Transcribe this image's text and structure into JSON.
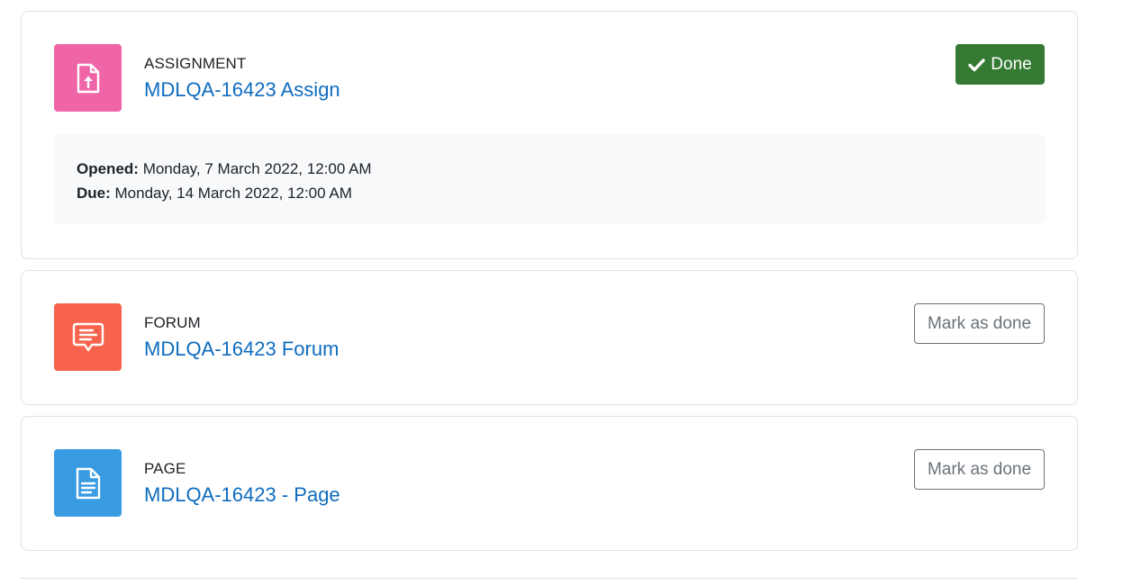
{
  "activities": [
    {
      "type": "ASSIGNMENT",
      "title": "MDLQA-16423 Assign",
      "icon": "assign-upload-icon",
      "icon_color": "#f065a8",
      "completion": {
        "label": "Done",
        "state": "done",
        "icon": "check-icon"
      },
      "dates": [
        {
          "label": "Opened:",
          "value": "Monday, 7 March 2022, 12:00 AM"
        },
        {
          "label": "Due:",
          "value": "Monday, 14 March 2022, 12:00 AM"
        }
      ]
    },
    {
      "type": "FORUM",
      "title": "MDLQA-16423 Forum",
      "icon": "forum-chat-icon",
      "icon_color": "#f7634d",
      "completion": {
        "label": "Mark as done",
        "state": "pending"
      }
    },
    {
      "type": "PAGE",
      "title": "MDLQA-16423 - Page",
      "icon": "page-document-icon",
      "icon_color": "#399be2",
      "completion": {
        "label": "Mark as done",
        "state": "pending"
      }
    }
  ],
  "colors": {
    "link": "#0f6cbf",
    "done_button": "#357a32",
    "outline_button": "#6a737b"
  }
}
